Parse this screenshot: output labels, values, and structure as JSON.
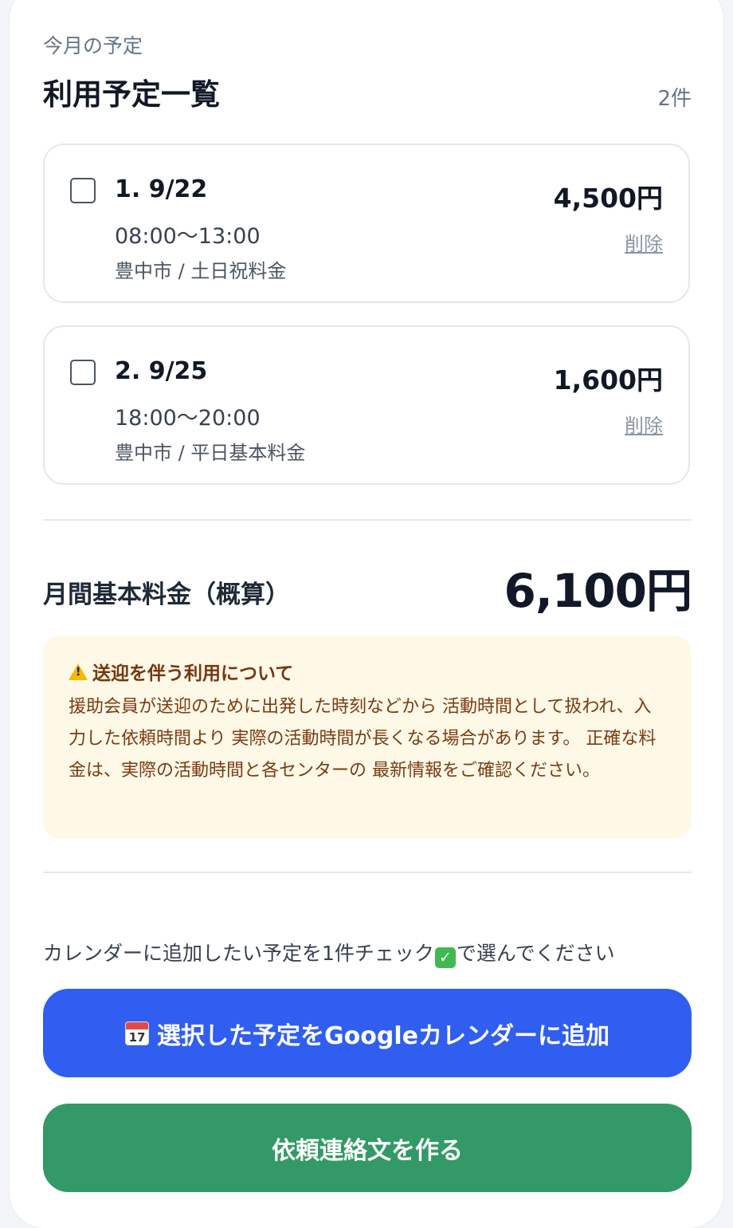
{
  "header": {
    "subtitle": "今月の予定",
    "title": "利用予定一覧",
    "count": "2件"
  },
  "items": [
    {
      "date": "1. 9/22",
      "time": "08:00〜13:00",
      "meta": "豊中市 / 土日祝料金",
      "price": "4,500円",
      "delete_label": "削除",
      "checked": false
    },
    {
      "date": "2. 9/25",
      "time": "18:00〜20:00",
      "meta": "豊中市 / 平日基本料金",
      "price": "1,600円",
      "delete_label": "削除",
      "checked": false
    }
  ],
  "total": {
    "label": "月間基本料金（概算）",
    "value": "6,100円"
  },
  "notice": {
    "icon": "warning-icon",
    "title": "送迎を伴う利用について",
    "body": "援助会員が送迎のために出発した時刻などから 活動時間として扱われ、入力した依頼時間より 実際の活動時間が長くなる場合があります。 正確な料金は、実際の活動時間と各センターの 最新情報をご確認ください。"
  },
  "hint": {
    "before": "カレンダーに追加したい予定を1件チェック",
    "after": "で選んでください"
  },
  "buttons": {
    "google_calendar": {
      "icon": "calendar-icon",
      "icon_number": "17",
      "label": "選択した予定をGoogleカレンダーに追加",
      "color": "#2f5ef0"
    },
    "request": {
      "label": "依頼連絡文を作る",
      "color": "#339966"
    }
  }
}
